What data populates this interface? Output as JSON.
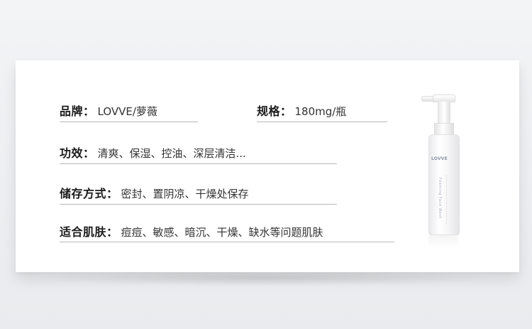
{
  "specs": {
    "brand": {
      "label": "品牌：",
      "value": "LOVVE/萝薇"
    },
    "size": {
      "label": "规格：",
      "value": "180mg/瓶"
    },
    "effect": {
      "label": "功效：",
      "value": "清爽、保湿、控油、深层清洁..."
    },
    "storage": {
      "label": "储存方式：",
      "value": "密封、置阴凉、干燥处保存"
    },
    "skin": {
      "label": "适合肌肤：",
      "value": "痘痘、敏感、暗沉、干燥、缺水等问题肌肤"
    }
  },
  "product": {
    "logo_text": "LOVVE",
    "vertical_text": "Foaming Face Wash"
  },
  "colors": {
    "label": "#1a1a1a",
    "value": "#333333",
    "rule": "#b9b9b9",
    "card": "#ffffff"
  }
}
